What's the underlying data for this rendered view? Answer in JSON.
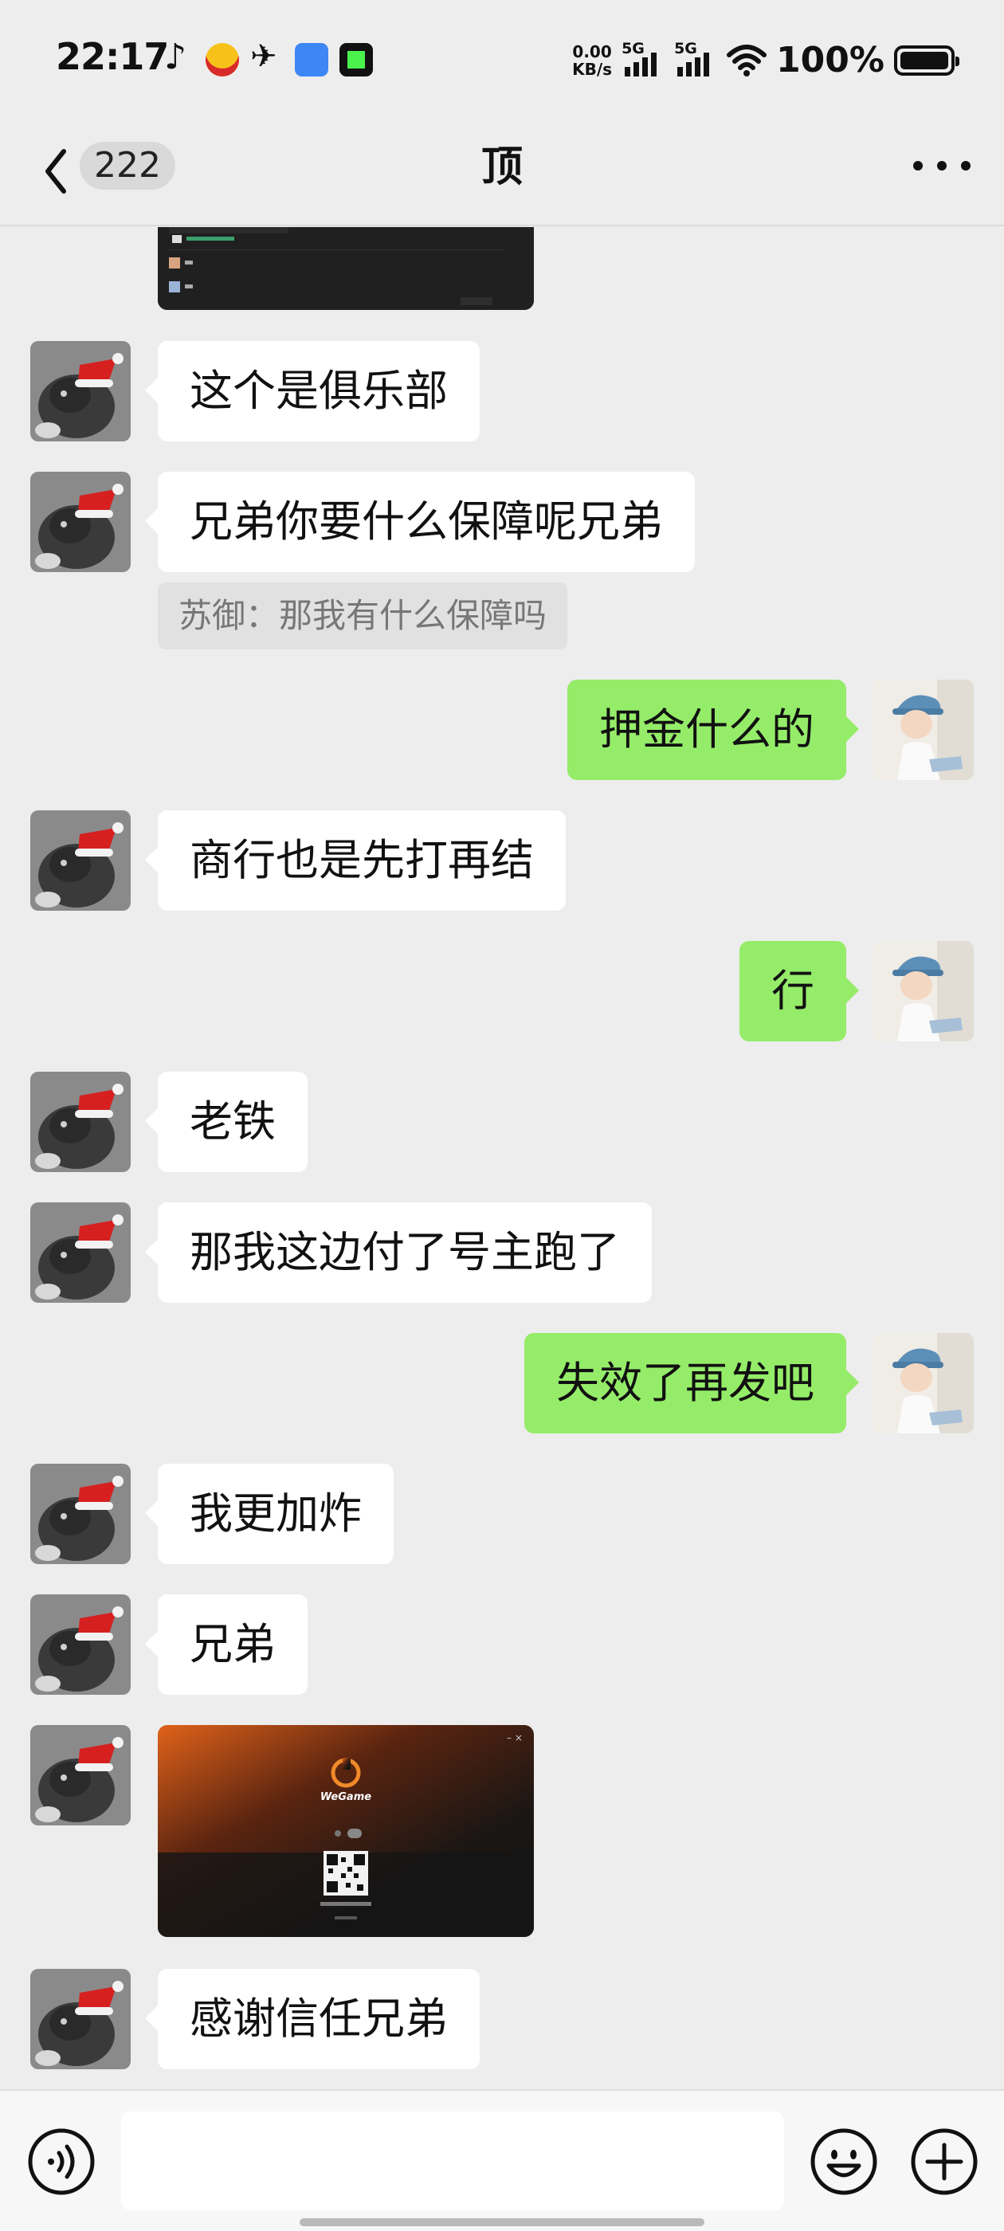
{
  "status_bar": {
    "time": "22:17",
    "net_speed_value": "0.00",
    "net_speed_unit": "KB/s",
    "signal1_label": "5G",
    "signal2_label": "5G",
    "battery_percent": "100%"
  },
  "nav": {
    "unread_count": "222",
    "title": "顶"
  },
  "messages": [
    {
      "side": "in",
      "type": "image",
      "desc": "screenshot-dark"
    },
    {
      "side": "in",
      "type": "text",
      "text": "这个是俱乐部"
    },
    {
      "side": "in",
      "type": "text",
      "text": "兄弟你要什么保障呢兄弟",
      "quote": "苏御：那我有什么保障吗"
    },
    {
      "side": "out",
      "type": "text",
      "text": "押金什么的"
    },
    {
      "side": "in",
      "type": "text",
      "text": "商行也是先打再结"
    },
    {
      "side": "out",
      "type": "text",
      "text": "行"
    },
    {
      "side": "in",
      "type": "text",
      "text": "老铁"
    },
    {
      "side": "in",
      "type": "text",
      "text": "那我这边付了号主跑了"
    },
    {
      "side": "out",
      "type": "text",
      "text": "失效了再发吧"
    },
    {
      "side": "in",
      "type": "text",
      "text": "我更加炸"
    },
    {
      "side": "in",
      "type": "text",
      "text": "兄弟"
    },
    {
      "side": "in",
      "type": "image",
      "desc": "wegame-login-qr",
      "app_label": "WeGame"
    },
    {
      "side": "in",
      "type": "text",
      "text": "感谢信任兄弟"
    }
  ],
  "input": {
    "placeholder": ""
  },
  "colors": {
    "background": "#ededed",
    "outgoing_bubble": "#95ec69",
    "incoming_bubble": "#ffffff"
  }
}
